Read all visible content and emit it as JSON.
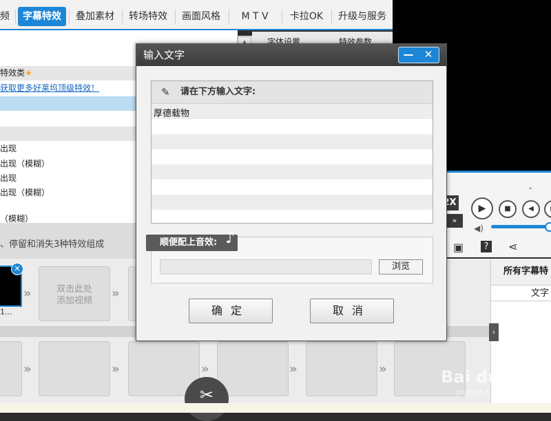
{
  "tabs": [
    {
      "label": "频"
    },
    {
      "label": "字幕特效"
    },
    {
      "label": "叠加素材"
    },
    {
      "label": "转场特效"
    },
    {
      "label": "画面风格"
    },
    {
      "label": "M T V"
    },
    {
      "label": "卡拉OK"
    },
    {
      "label": "升级与服务"
    }
  ],
  "subtabs": {
    "font_settings": "字体设置",
    "effect_params": "特效参数"
  },
  "effect_list": {
    "rows": [
      "",
      "特效类",
      "获取更多好莱坞顶级特效！",
      "",
      "",
      "",
      "",
      "出现",
      "出现（模糊）",
      "出现",
      "出现（模糊）",
      "",
      "（模糊）"
    ]
  },
  "info_text": "、停留和消失3种特效组成",
  "timeline": {
    "clip_label": "1...",
    "add_video": [
      "双击此处",
      "添加视频"
    ]
  },
  "player": {
    "speed_label": "2X",
    "ff_label": "»"
  },
  "right_panel": {
    "header": "所有字幕特",
    "column": "文字"
  },
  "dialog": {
    "title": "输入文字",
    "prompt": "请在下方输入文字:",
    "text_value": "厚德载物",
    "sound_label": "顺便配上音效:",
    "browse_label": "浏览",
    "ok_label": "确定",
    "cancel_label": "取消",
    "minimize": "—",
    "close": "✕"
  },
  "watermark": {
    "main": "Bai du 经验",
    "sub": "jingyan.baidu.com"
  },
  "colors": {
    "accent": "#1e86d6",
    "star": "#f5a623"
  }
}
